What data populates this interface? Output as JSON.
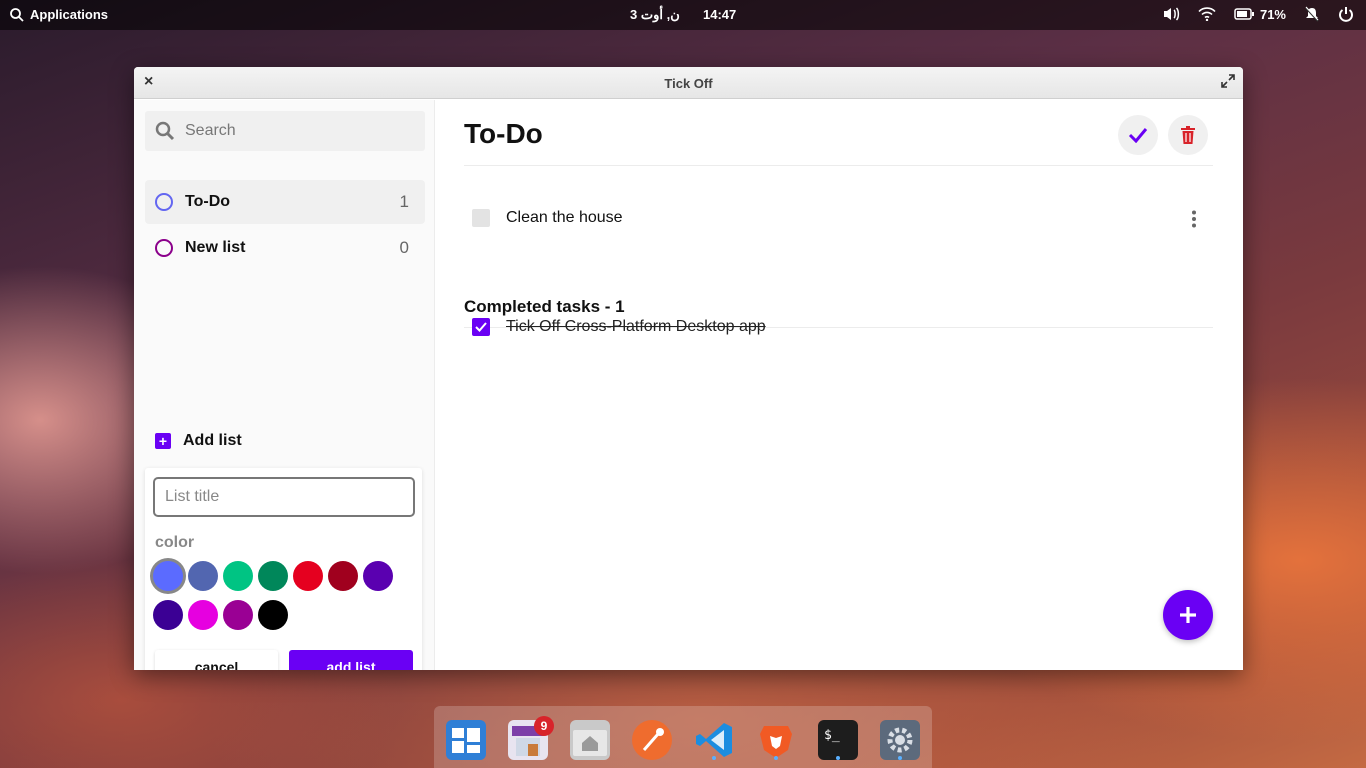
{
  "top_panel": {
    "applications_label": "Applications",
    "date": "3  ن, أوت",
    "time": "14:47",
    "battery": "71%"
  },
  "window": {
    "title": "Tick Off"
  },
  "sidebar": {
    "search_placeholder": "Search",
    "lists": [
      {
        "name": "To-Do",
        "count": "1",
        "color": "#6366f1"
      },
      {
        "name": "New list",
        "count": "0",
        "color": "#8b008b"
      }
    ],
    "add_list_label": "Add list",
    "form": {
      "title_placeholder": "List title",
      "color_label": "color",
      "colors": [
        "#5b6bff",
        "#5266b0",
        "#00c483",
        "#00875a",
        "#e5001f",
        "#a0001e",
        "#5a00b0",
        "#3b0094",
        "#e600e0",
        "#9a0094",
        "#000000"
      ],
      "cancel_label": "cancel",
      "add_label": "add list"
    }
  },
  "main": {
    "heading": "To-Do",
    "tasks": [
      {
        "text": "Clean the house",
        "done": false
      }
    ],
    "completed_heading": "Completed tasks - 1",
    "completed_tasks": [
      {
        "text": "Tick Off Cross-Platform Desktop app",
        "done": true
      }
    ]
  },
  "dock": {
    "badge_count": "9",
    "icons": [
      "multitasking-view-icon",
      "appcenter-icon",
      "files-icon",
      "postman-icon",
      "vscode-icon",
      "brave-icon",
      "terminal-icon",
      "settings-icon"
    ]
  },
  "accent_color": "#6a00f4",
  "danger_color": "#d8232a"
}
